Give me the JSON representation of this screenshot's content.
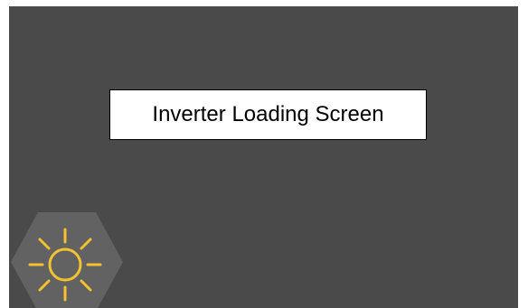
{
  "screen": {
    "title": "Inverter Loading Screen"
  },
  "badge": {
    "icon": "sun-icon"
  },
  "colors": {
    "background": "#4a4a4a",
    "hexagon": "#626262",
    "sun": "#f2c230",
    "title_box": "#ffffff"
  }
}
